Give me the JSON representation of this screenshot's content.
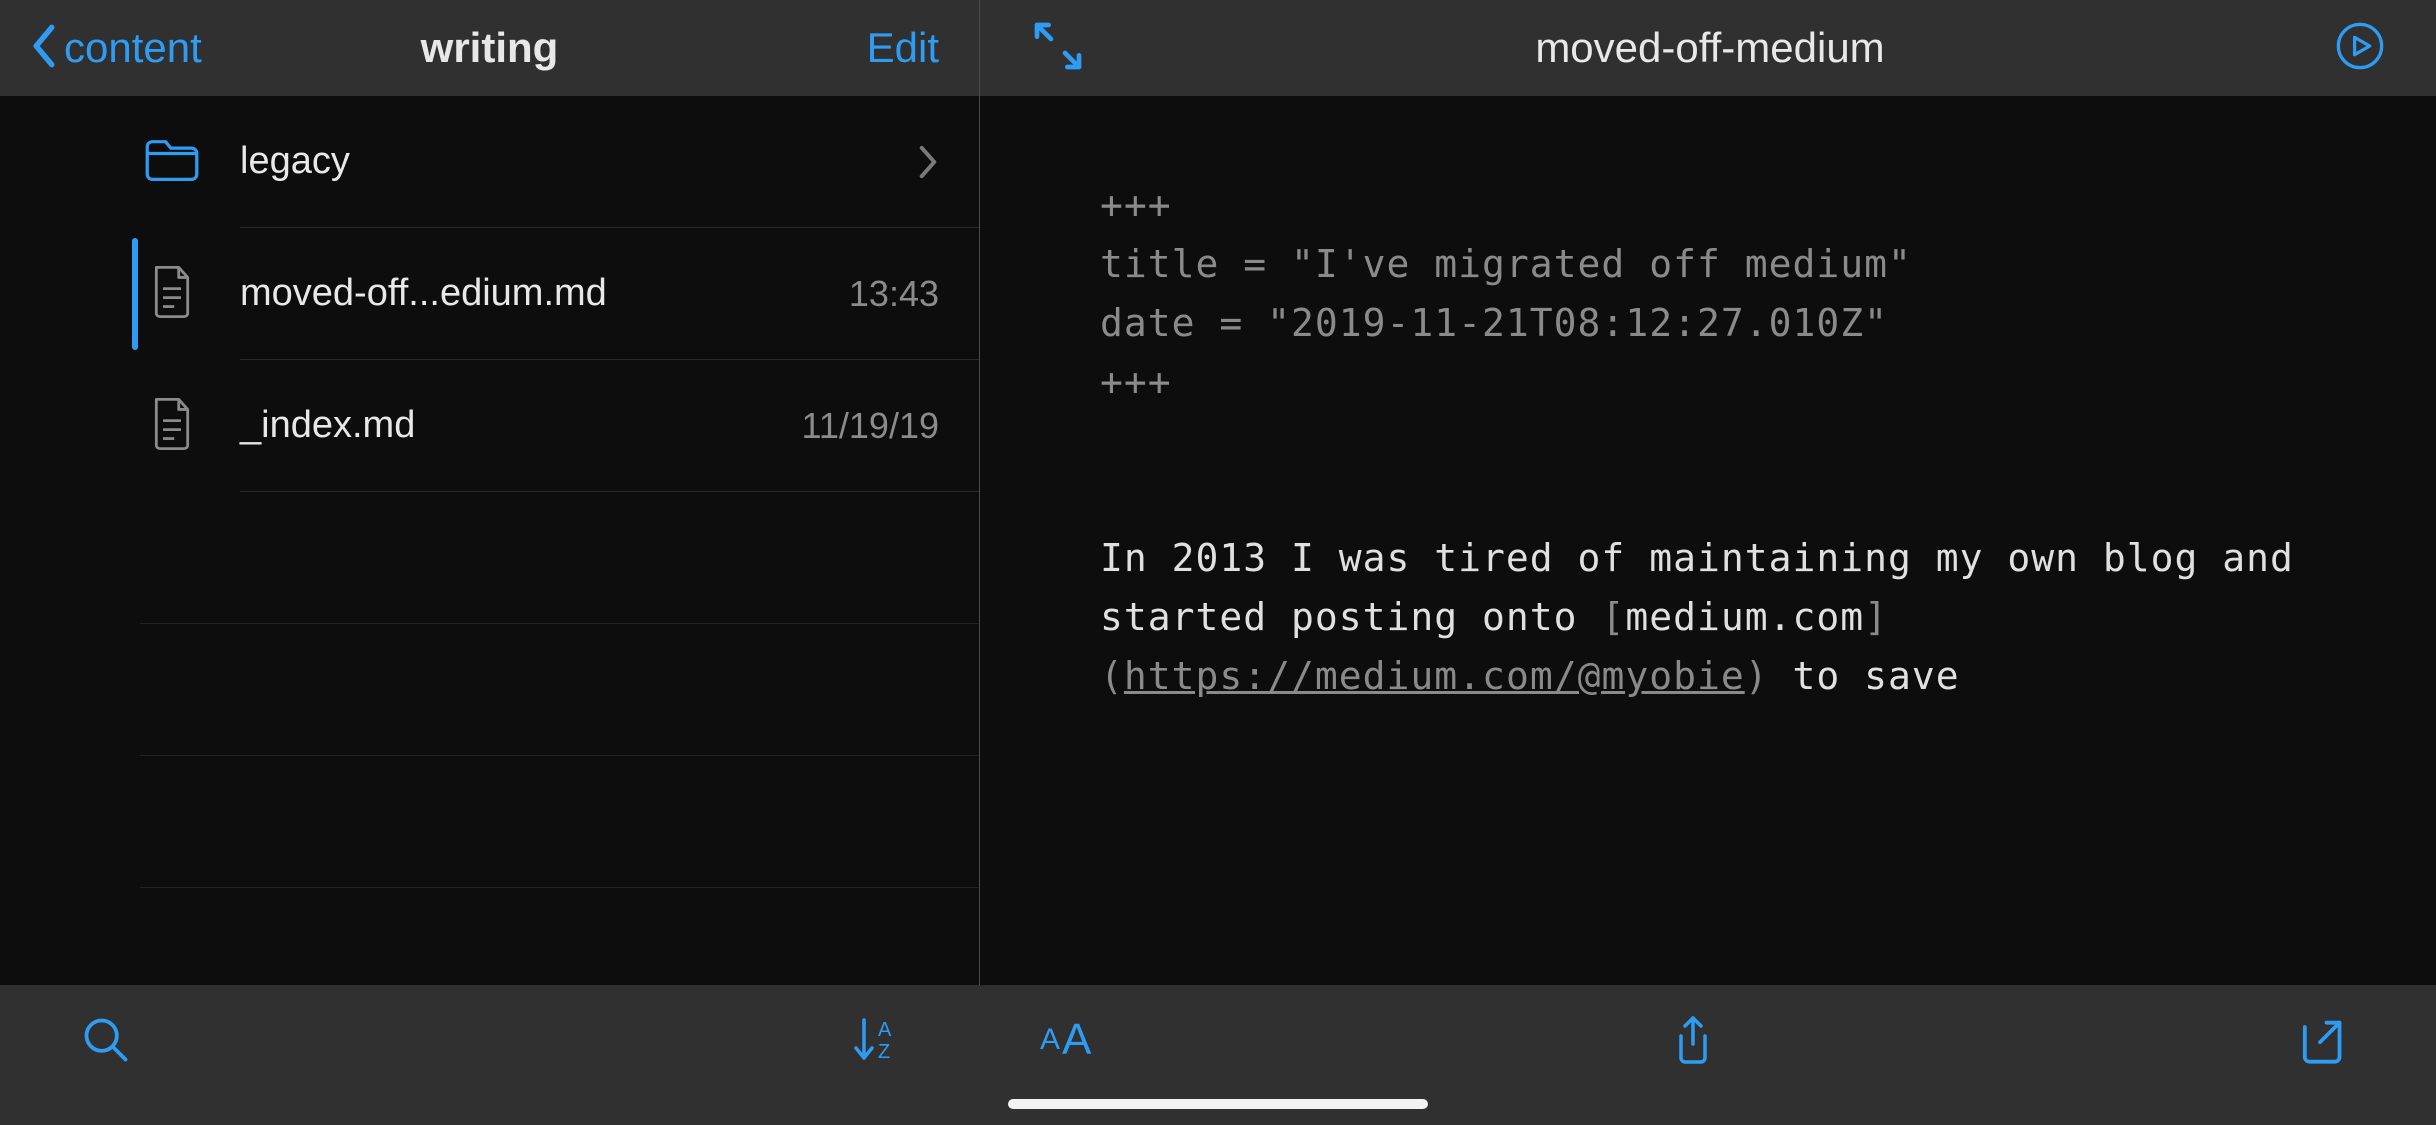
{
  "left": {
    "back_label": "content",
    "title": "writing",
    "edit_label": "Edit",
    "items": [
      {
        "type": "folder",
        "name": "legacy",
        "meta": ""
      },
      {
        "type": "file",
        "name": "moved-off...edium.md",
        "meta": "13:43",
        "selected": true
      },
      {
        "type": "file",
        "name": "_index.md",
        "meta": "11/19/19"
      }
    ]
  },
  "right": {
    "title": "moved-off-medium"
  },
  "editor": {
    "delim_top": "+++",
    "line_title": "title = \"I've migrated off medium\"",
    "line_date": "date = \"2019-11-21T08:12:27.010Z\"",
    "delim_bottom": "+++",
    "body_part1": "In 2013 I was tired of maintaining my own blog and started posting onto ",
    "body_bracket_open": "[",
    "body_linktext": "medium.com",
    "body_bracket_close": "]",
    "body_paren_open": "(",
    "body_url": "https://medium.com/@myobie",
    "body_paren_close": ")",
    "body_part2": " to save"
  }
}
